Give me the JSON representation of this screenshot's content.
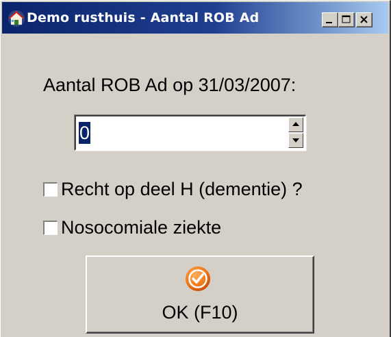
{
  "window": {
    "title": "Demo rusthuis - Aantal ROB Ad",
    "icon": "house-icon",
    "controls": [
      "minimize-icon",
      "maximize-icon",
      "close-icon"
    ]
  },
  "form": {
    "prompt": "Aantal ROB Ad op 31/03/2007:",
    "spinner": {
      "value": "0",
      "up_icon": "arrow-up-icon",
      "down_icon": "arrow-down-icon"
    },
    "checkboxes": [
      {
        "label": "Recht op deel H (dementie) ?",
        "checked": false
      },
      {
        "label": "Nosocomiale ziekte",
        "checked": false
      }
    ]
  },
  "ok_button": {
    "label": "OK (F10)",
    "icon": "checkmark-circle-icon",
    "icon_color": "#f07818"
  },
  "colors": {
    "titlebar": "#0a246a",
    "face": "#d4d0c8",
    "selection": "#0a246a"
  }
}
